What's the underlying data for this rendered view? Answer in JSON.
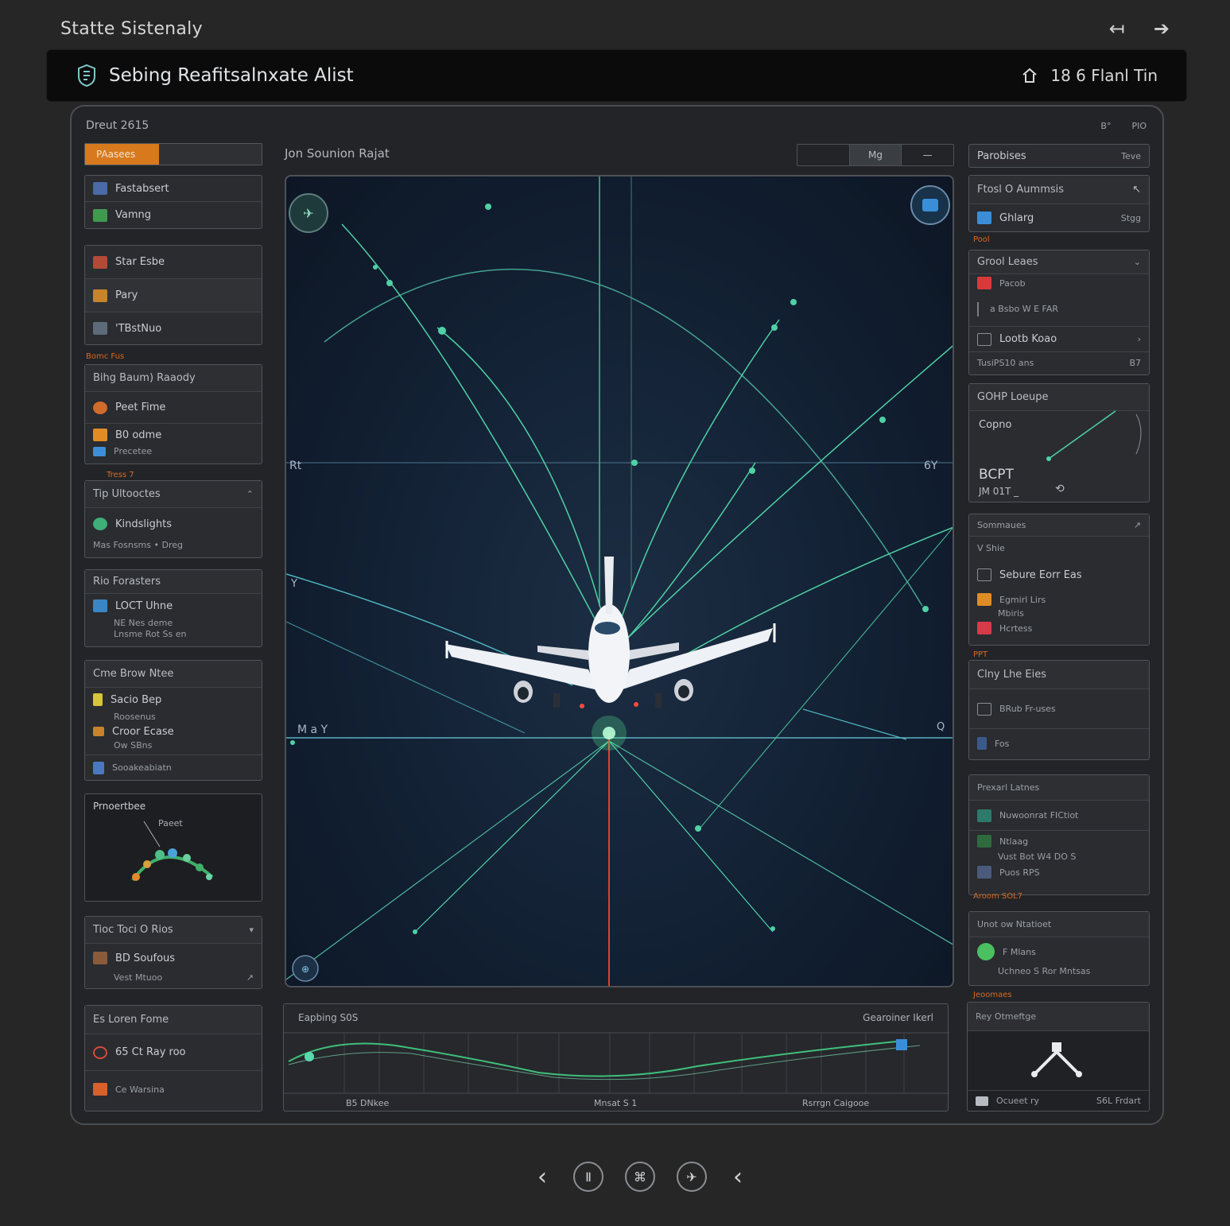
{
  "window": {
    "title": "Statte Sistenaly",
    "nav_back": "↤",
    "nav_forward": "➔"
  },
  "header": {
    "title": "Sebing Reafitsalnxate Alist",
    "status_text": "18 6 Flanl Tin"
  },
  "frame": {
    "label": "Dreut 2615",
    "corner_a": "B°",
    "corner_b": "PIO"
  },
  "progress": {
    "label": "PAasees",
    "fraction": 0.42
  },
  "left": {
    "p1": [
      "Fastabsert",
      "Vamng"
    ],
    "p2": [
      "Star Esbe",
      "Pary",
      "'TBstNuo"
    ],
    "label3": "Bomc Fus",
    "p3": {
      "header": "Bihg Baum) Raaody",
      "items": [
        "Peet Fime",
        "B0 odme"
      ],
      "sub": "Precetee"
    },
    "label4": "Tress 7",
    "p4": {
      "header": "Tip Ultooctes",
      "item": "Kindslights",
      "sub": "Mas Fosnsms • Dreg"
    },
    "p5": {
      "header": "Rio Forasters",
      "item": "LOCT Uhne",
      "sub1": "NE  Nes deme",
      "sub2": "Lnsme Rot Ss en"
    },
    "p6": {
      "header": "Cme Brow Ntee",
      "item1": "Sacio Bep",
      "sub1": "Roosenus",
      "item2": "Croor Ecase",
      "sub2": "Ow SBns",
      "item3": "Sooakeabiatn"
    },
    "p7": {
      "header": "Prnoertbee",
      "label": "Paeet"
    },
    "p8": {
      "header": "Tioc Toci O Rios",
      "item": "BD Soufous",
      "sub": "Vest   Mtuoo"
    },
    "p9": {
      "header": "Es Loren Fome",
      "item1": "65 Ct Ray roo",
      "item2": "Ce Warsina"
    }
  },
  "viewport": {
    "title": "Jon Sounion Rajat",
    "tabs": [
      "",
      "Mg",
      "—"
    ],
    "axis_left": "Rt",
    "axis_right": "6Y",
    "axis_y": "Y",
    "axis_bottom": "M a Y",
    "axis_right2": "Q"
  },
  "timeline": {
    "left_label": "Eapbing S0S",
    "right_label": "Gearoiner Ikerl",
    "tick_a": "B5 DNkee",
    "tick_b": "Mnsat  S 1",
    "tick_c": "Rsrrgn Caigooe"
  },
  "right": {
    "tab": {
      "label": "Parobises",
      "right": "Teve"
    },
    "p1": {
      "header": "Ftosl O Aummsis",
      "item": "Ghlarg",
      "item_right": "Stgg"
    },
    "label1": "Pool",
    "p2": {
      "header": "Grool Leaes",
      "item1": "Pacob",
      "item2": "a Bsbo  W E  FAR",
      "item3": "Lootb Koao",
      "footer": "TusiPS10 ans",
      "footer_right": "B7"
    },
    "p3": {
      "header": "GOHP Loeupe",
      "label": "Copno",
      "value1": "BCPT",
      "value2": "JM  01T _"
    },
    "p4": {
      "header": "Sommaues",
      "item1": "V  Shie",
      "item2": "Sebure  Eorr Eas",
      "item3": "Egmirl Lirs",
      "sub3": "Mbiris",
      "item4": "Hcrtess"
    },
    "label4": "PPT",
    "p5": {
      "header": "Clny Lhe Eies",
      "item1": "BRub Fr-uses",
      "item2": "Fos"
    },
    "p6": {
      "header": "Prexarl Latnes",
      "item1": "Nuwoonrat FICtiot",
      "item2": "Ntlaag",
      "sub2": "Vust  Bot  W4 DO S",
      "item3": "Puos RPS"
    },
    "label6": "Aroom SOL7",
    "p7": {
      "header": "Unot ow Ntatioet",
      "item": "F  Mlans",
      "sub": "Uchneo S  Ror Mntsas"
    },
    "label7": "Jeoomaes",
    "p8": {
      "header": "Rey Otmeftge",
      "footer_left": "Ocueet ry",
      "footer_right": "S6L Frdart"
    }
  },
  "toolbar": {
    "b1": "Ⅱ",
    "b2": "⌘",
    "b3": "✈"
  },
  "colors": {
    "accent_orange": "#d7791c",
    "trajectory": "#4fd1a5",
    "viewport_bg": "#122033",
    "red_line": "#e0402e"
  }
}
